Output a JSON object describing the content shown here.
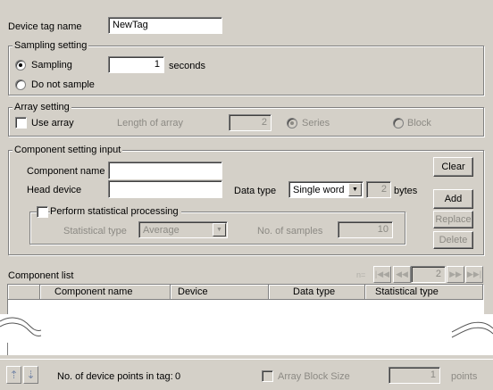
{
  "device_tag": {
    "label": "Device tag name",
    "value": "NewTag"
  },
  "sampling": {
    "title": "Sampling setting",
    "sampling_label": "Sampling",
    "seconds_value": "1",
    "seconds_unit": "seconds",
    "no_sample_label": "Do not sample"
  },
  "array": {
    "title": "Array setting",
    "use_array_label": "Use array",
    "length_label": "Length of array",
    "length_value": "2",
    "series_label": "Series",
    "block_label": "Block"
  },
  "component_input": {
    "title": "Component setting input",
    "name_label": "Component name",
    "name_value": "",
    "head_device_label": "Head device",
    "head_device_value": "",
    "data_type_label": "Data type",
    "data_type_value": "Single word",
    "bytes_value": "2",
    "bytes_unit": "bytes",
    "clear_label": "Clear",
    "add_label": "Add",
    "replace_label": "Replace",
    "delete_label": "Delete",
    "stat_processing_label": "Perform statistical processing",
    "stat_type_label": "Statistical type",
    "stat_type_value": "Average",
    "samples_label": "No. of samples",
    "samples_value": "10"
  },
  "component_list": {
    "title": "Component list",
    "nav_value": "2",
    "columns": [
      "Component name",
      "Device",
      "Data type",
      "Statistical type"
    ]
  },
  "footer": {
    "points_label": "No. of device points in tag:",
    "points_value": "0",
    "array_block_label": "Array Block Size",
    "array_block_value": "1",
    "points_unit": "points"
  }
}
